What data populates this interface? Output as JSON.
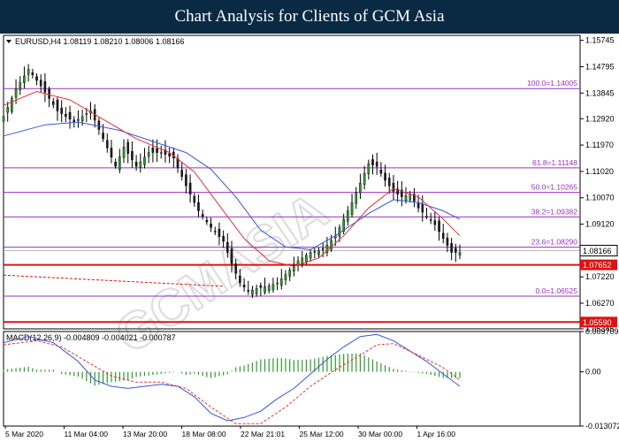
{
  "banner": {
    "title": "Chart Analysis for Clients of GCM Asia"
  },
  "chart_data": [
    {
      "type": "candlestick",
      "symbol_label": "EURUSD,H4",
      "ohlc_header": "1.08119 1.08210 1.08006 1.08166",
      "ylim": [
        1.05345,
        1.15925
      ],
      "y_ticks": [
        "1.15745",
        "1.14795",
        "1.13845",
        "1.12920",
        "1.11970",
        "1.11020",
        "1.10070",
        "1.09120",
        "1.07220",
        "1.06270",
        "1.05345"
      ],
      "x_ticks": [
        "5 Mar 2020",
        "11 Mar 04:00",
        "13 Mar 20:00",
        "18 Mar 08:00",
        "22 Mar 21:01",
        "25 Mar 12:00",
        "30 Mar 00:00",
        "1 Apr 16:00"
      ],
      "colors": {
        "bull": "#2e9a2e",
        "bear": "#1f1f1f",
        "ma_fast": "#e8303a",
        "ma_slow": "#3a52d8",
        "fib": "#9b30c0",
        "support": "#e01010"
      },
      "fibonacci": [
        {
          "label": "100.0=1.14005",
          "price": 1.14005
        },
        {
          "label": "61.8=1.11148",
          "price": 1.11148
        },
        {
          "label": "50.0=1.10265",
          "price": 1.10265
        },
        {
          "label": "38.2=1.09382",
          "price": 1.09382
        },
        {
          "label": "23.6=1.08290",
          "price": 1.0829
        },
        {
          "label": "0.0=1.06525",
          "price": 1.06525
        }
      ],
      "support_levels": [
        {
          "label": "1.07652",
          "price": 1.07652
        },
        {
          "label": "1.05590",
          "price": 1.0559
        }
      ],
      "current_price": {
        "label": "1.08166",
        "price": 1.08166
      },
      "close_path": [
        [
          0,
          1.13
        ],
        [
          3,
          1.14
        ],
        [
          6,
          1.147
        ],
        [
          9,
          1.141
        ],
        [
          13,
          1.132
        ],
        [
          17,
          1.128
        ],
        [
          21,
          1.132
        ],
        [
          24,
          1.122
        ],
        [
          27,
          1.112
        ],
        [
          29,
          1.119
        ],
        [
          32,
          1.112
        ],
        [
          35,
          1.117
        ],
        [
          38,
          1.117
        ],
        [
          41,
          1.115
        ],
        [
          44,
          1.105
        ],
        [
          47,
          1.096
        ],
        [
          50,
          1.09
        ],
        [
          53,
          1.085
        ],
        [
          55,
          1.077
        ],
        [
          57,
          1.07
        ],
        [
          59,
          1.067
        ],
        [
          61,
          1.068
        ],
        [
          64,
          1.069
        ],
        [
          66,
          1.07
        ],
        [
          68,
          1.073
        ],
        [
          71,
          1.078
        ],
        [
          74,
          1.081
        ],
        [
          77,
          1.082
        ],
        [
          80,
          1.087
        ],
        [
          82,
          1.093
        ],
        [
          84,
          1.099
        ],
        [
          86,
          1.106
        ],
        [
          88,
          1.113
        ],
        [
          90,
          1.112
        ],
        [
          92,
          1.107
        ],
        [
          94,
          1.103
        ],
        [
          96,
          1.101
        ],
        [
          98,
          1.102
        ],
        [
          100,
          1.097
        ],
        [
          102,
          1.094
        ],
        [
          104,
          1.091
        ],
        [
          106,
          1.086
        ],
        [
          108,
          1.081
        ],
        [
          110,
          1.081
        ]
      ],
      "ma_fast_path": [
        [
          0,
          1.134
        ],
        [
          8,
          1.139
        ],
        [
          16,
          1.136
        ],
        [
          24,
          1.129
        ],
        [
          32,
          1.122
        ],
        [
          40,
          1.117
        ],
        [
          46,
          1.11
        ],
        [
          52,
          1.098
        ],
        [
          58,
          1.086
        ],
        [
          64,
          1.078
        ],
        [
          70,
          1.076
        ],
        [
          76,
          1.079
        ],
        [
          82,
          1.087
        ],
        [
          88,
          1.097
        ],
        [
          94,
          1.104
        ],
        [
          100,
          1.101
        ],
        [
          106,
          1.093
        ],
        [
          110,
          1.087
        ]
      ],
      "ma_slow_path": [
        [
          0,
          1.123
        ],
        [
          10,
          1.127
        ],
        [
          18,
          1.128
        ],
        [
          28,
          1.125
        ],
        [
          36,
          1.121
        ],
        [
          44,
          1.117
        ],
        [
          50,
          1.111
        ],
        [
          56,
          1.101
        ],
        [
          62,
          1.089
        ],
        [
          68,
          1.083
        ],
        [
          74,
          1.082
        ],
        [
          80,
          1.087
        ],
        [
          88,
          1.095
        ],
        [
          94,
          1.1
        ],
        [
          100,
          1.099
        ],
        [
          106,
          1.096
        ],
        [
          110,
          1.093
        ]
      ],
      "trend_line": [
        [
          0,
          1.0728
        ],
        [
          53,
          1.0688
        ]
      ]
    },
    {
      "type": "macd",
      "label": "MACD(12,26,9) -0.004809 -0.004021 -0.000787",
      "ylim": [
        -0.013072,
        0.009709
      ],
      "y_ticks": [
        "0.009709",
        "0.00",
        "-0.013072"
      ],
      "macd_path": [
        [
          0,
          0.007
        ],
        [
          6,
          0.0085
        ],
        [
          12,
          0.007
        ],
        [
          18,
          0.0025
        ],
        [
          22,
          -0.002
        ],
        [
          26,
          -0.0035
        ],
        [
          30,
          -0.004
        ],
        [
          34,
          -0.0035
        ],
        [
          38,
          -0.003
        ],
        [
          42,
          -0.0035
        ],
        [
          46,
          -0.006
        ],
        [
          50,
          -0.01
        ],
        [
          54,
          -0.0118
        ],
        [
          58,
          -0.011
        ],
        [
          62,
          -0.0095
        ],
        [
          66,
          -0.0065
        ],
        [
          70,
          -0.004
        ],
        [
          74,
          -0.0005
        ],
        [
          78,
          0.003
        ],
        [
          82,
          0.006
        ],
        [
          86,
          0.0085
        ],
        [
          90,
          0.009
        ],
        [
          94,
          0.0075
        ],
        [
          98,
          0.005
        ],
        [
          102,
          0.0025
        ],
        [
          106,
          -0.0005
        ],
        [
          110,
          -0.0035
        ]
      ],
      "signal_path": [
        [
          0,
          0.0065
        ],
        [
          8,
          0.0075
        ],
        [
          14,
          0.006
        ],
        [
          20,
          0.0025
        ],
        [
          26,
          -0.001
        ],
        [
          32,
          -0.0025
        ],
        [
          38,
          -0.0025
        ],
        [
          44,
          -0.004
        ],
        [
          50,
          -0.0085
        ],
        [
          56,
          -0.0125
        ],
        [
          62,
          -0.0125
        ],
        [
          68,
          -0.0085
        ],
        [
          74,
          -0.0035
        ],
        [
          80,
          0.0005
        ],
        [
          86,
          0.004
        ],
        [
          90,
          0.0065
        ],
        [
          94,
          0.0068
        ],
        [
          100,
          0.004
        ],
        [
          106,
          0.001
        ],
        [
          110,
          -0.002
        ]
      ]
    }
  ]
}
